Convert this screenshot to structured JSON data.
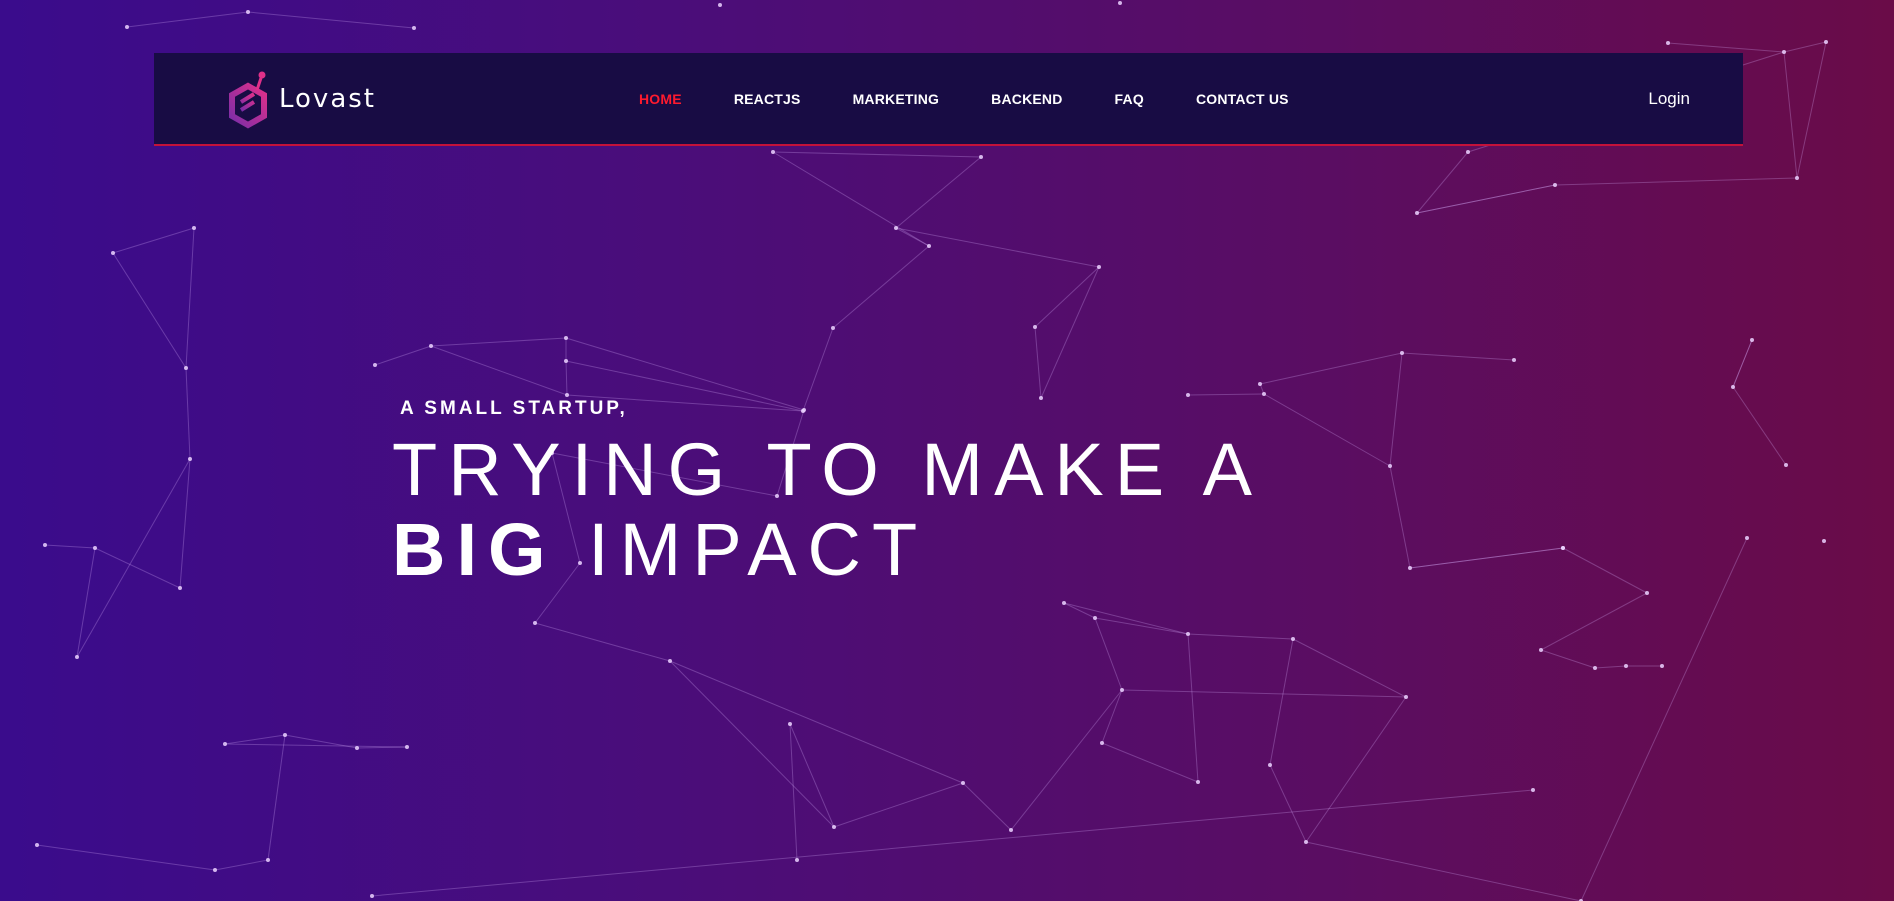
{
  "brand": {
    "logo_text": "Lovast",
    "logo_icon": "hexagon-logo-icon",
    "accent_color": "#ff1a2e",
    "nav_bg": "#180c44"
  },
  "nav": {
    "items": [
      {
        "label": "HOME",
        "active": true
      },
      {
        "label": "REACTJS",
        "active": false
      },
      {
        "label": "MARKETING",
        "active": false
      },
      {
        "label": "BACKEND",
        "active": false
      },
      {
        "label": "FAQ",
        "active": false
      },
      {
        "label": "CONTACT US",
        "active": false
      }
    ],
    "login_label": "Login"
  },
  "hero": {
    "kicker": "A SMALL STARTUP,",
    "line1": "TRYING TO MAKE A",
    "line2_bold": "BIG",
    "line2_rest": " IMPACT"
  }
}
